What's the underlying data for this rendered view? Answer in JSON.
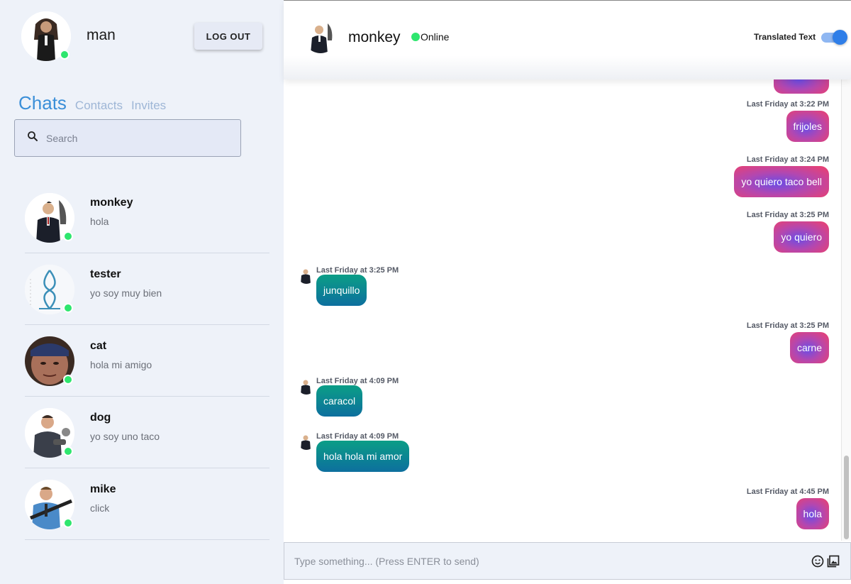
{
  "sidebar": {
    "me": {
      "name": "man",
      "logout_label": "LOG OUT"
    },
    "tabs": [
      "Chats",
      "Contacts",
      "Invites"
    ],
    "search": {
      "placeholder": "Search"
    },
    "chats": [
      {
        "name": "monkey",
        "last_message": "hola"
      },
      {
        "name": "tester",
        "last_message": "yo soy muy bien"
      },
      {
        "name": "cat",
        "last_message": "hola mi amigo"
      },
      {
        "name": "dog",
        "last_message": "yo soy uno taco"
      },
      {
        "name": "mike",
        "last_message": "click"
      }
    ]
  },
  "header": {
    "name": "monkey",
    "status": "Online",
    "translate_label": "Translated Text",
    "translate_on": true
  },
  "messages": [
    {
      "time": "Last Friday at 3:22 PM",
      "text": "frijoles",
      "dir": "out"
    },
    {
      "time": "Last Friday at 3:24 PM",
      "text": "yo quiero taco bell",
      "dir": "out"
    },
    {
      "time": "Last Friday at 3:25 PM",
      "text": "yo quiero",
      "dir": "out"
    },
    {
      "time": "Last Friday at 3:25 PM",
      "text": "junquillo",
      "dir": "in"
    },
    {
      "time": "Last Friday at 3:25 PM",
      "text": "carne",
      "dir": "out"
    },
    {
      "time": "Last Friday at 4:09 PM",
      "text": "caracol",
      "dir": "in"
    },
    {
      "time": "Last Friday at 4:09 PM",
      "text": "hola hola mi amor",
      "dir": "in"
    },
    {
      "time": "Last Friday at 4:45 PM",
      "text": "hola",
      "dir": "out"
    }
  ],
  "composer": {
    "placeholder": "Type something... (Press ENTER to send)"
  },
  "colors": {
    "accent": "#3b8fd8",
    "online": "#2ee66e",
    "toggle": "#2f7ee8"
  }
}
